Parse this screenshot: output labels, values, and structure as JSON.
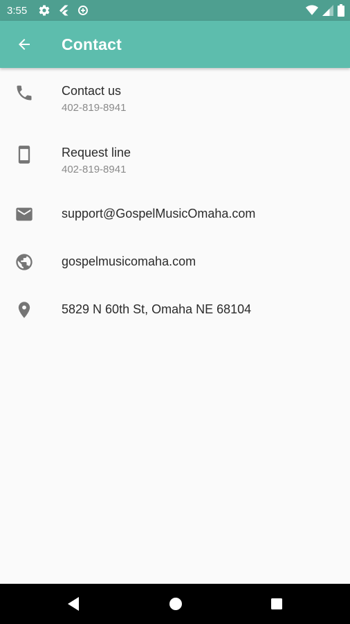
{
  "status_bar": {
    "time": "3:55",
    "icons": [
      "settings-icon",
      "flutter-icon",
      "data-saver-icon",
      "wifi-icon",
      "cell-signal-icon",
      "battery-icon"
    ],
    "color": "#4e9f90"
  },
  "app_bar": {
    "title": "Contact",
    "back_icon": "arrow-back-icon",
    "color": "#5dbdad"
  },
  "contacts": [
    {
      "icon": "phone-icon",
      "primary": "Contact us",
      "secondary": "402-819-8941"
    },
    {
      "icon": "smartphone-icon",
      "primary": "Request line",
      "secondary": "402-819-8941"
    },
    {
      "icon": "email-icon",
      "primary": "support@GospelMusicOmaha.com"
    },
    {
      "icon": "globe-icon",
      "primary": "gospelmusicomaha.com"
    },
    {
      "icon": "location-pin-icon",
      "primary": "5829 N 60th St, Omaha NE 68104"
    }
  ],
  "nav_bar": {
    "icons": [
      "nav-back-icon",
      "nav-home-icon",
      "nav-recents-icon"
    ]
  }
}
